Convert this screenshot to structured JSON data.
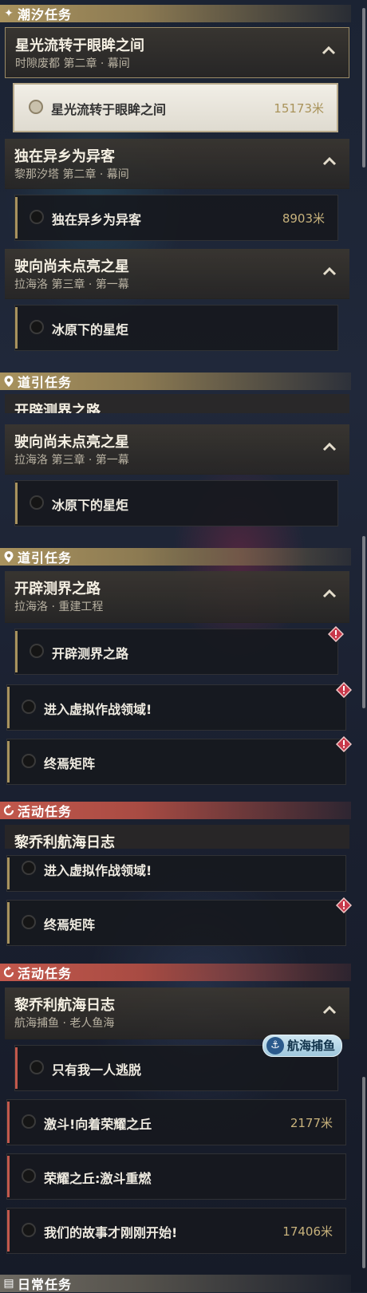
{
  "sections": {
    "s1": "潮汐任务",
    "s2": "道引任务",
    "s3": "道引任务",
    "s4": "活动任务",
    "s5": "活动任务",
    "s6": "日常任务"
  },
  "groups": {
    "g1": {
      "title": "星光流转于眼眸之间",
      "sub": "时隙废都 第二章 · 幕间"
    },
    "g2": {
      "title": "独在异乡为异客",
      "sub": "黎那汐塔 第二章 · 幕间"
    },
    "g3": {
      "title": "驶向尚未点亮之星",
      "sub": "拉海洛 第三章 · 第一幕"
    },
    "g4": {
      "title": "驶向尚未点亮之星",
      "sub": "拉海洛 第三章 · 第一幕"
    },
    "g5": {
      "title": "开辟测界之路",
      "sub": "拉海洛 · 重建工程"
    },
    "g6": {
      "title": "黎乔利航海日志",
      "sub": "航海捕鱼 · 老人鱼海"
    },
    "cut1": "开辟测界之路",
    "cut2": "黎乔利航海日志"
  },
  "rows": {
    "r1": {
      "label": "星光流转于眼眸之间",
      "dist": "15173米"
    },
    "r2": {
      "label": "独在异乡为异客",
      "dist": "8903米"
    },
    "r3": {
      "label": "冰原下的星炬"
    },
    "r4": {
      "label": "冰原下的星炬"
    },
    "r5": {
      "label": "开辟测界之路"
    },
    "r6": {
      "label": "进入虚拟作战领域!"
    },
    "r7": {
      "label": "终焉矩阵"
    },
    "r8": {
      "label": "进入虚拟作战领域!"
    },
    "r9": {
      "label": "终焉矩阵"
    },
    "r10": {
      "label": "只有我一人逃脱"
    },
    "r11": {
      "label": "激斗!向着荣耀之丘",
      "dist": "2177米"
    },
    "r12": {
      "label": "荣耀之丘:激斗重燃"
    },
    "r13": {
      "label": "我们的故事才刚刚开始!",
      "dist": "17406米"
    }
  },
  "badge": "航海捕鱼",
  "colors": {
    "gold": "#a8925e",
    "red": "#c2584c",
    "distance": "#c8b27c"
  },
  "icons": {
    "tide": "sparkle-icon",
    "guide": "location-pin-icon",
    "event": "refresh-icon",
    "chevron": "chevron-up-icon",
    "warning": "warning-diamond-icon"
  }
}
